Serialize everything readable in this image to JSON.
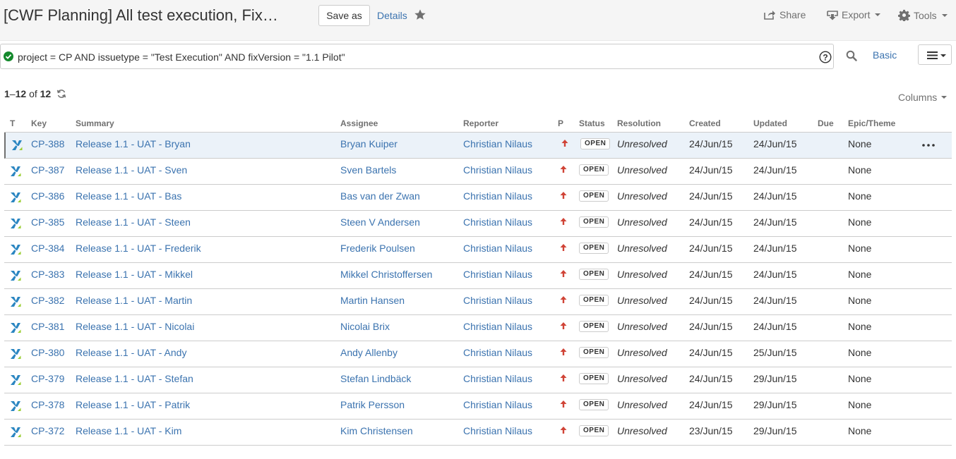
{
  "header": {
    "title": "[CWF Planning] All test execution, Fix…",
    "save_label": "Save as",
    "details_label": "Details",
    "share_label": "Share",
    "export_label": "Export",
    "tools_label": "Tools"
  },
  "search": {
    "query": "project = CP AND issuetype = \"Test Execution\" AND fixVersion = \"1.1 Pilot\"",
    "basic_label": "Basic"
  },
  "results": {
    "start": "1",
    "end": "12",
    "of_label": "of",
    "total": "12",
    "columns_label": "Columns"
  },
  "table": {
    "headers": {
      "type": "T",
      "key": "Key",
      "summary": "Summary",
      "assignee": "Assignee",
      "reporter": "Reporter",
      "priority": "P",
      "status": "Status",
      "resolution": "Resolution",
      "created": "Created",
      "updated": "Updated",
      "due": "Due",
      "epic": "Epic/Theme"
    },
    "rows": [
      {
        "key": "CP-388",
        "summary": "Release 1.1 - UAT - Bryan",
        "assignee": "Bryan Kuiper",
        "reporter": "Christian Nilaus",
        "status": "OPEN",
        "resolution": "Unresolved",
        "created": "24/Jun/15",
        "updated": "24/Jun/15",
        "due": "",
        "epic": "None"
      },
      {
        "key": "CP-387",
        "summary": "Release 1.1 - UAT - Sven",
        "assignee": "Sven Bartels",
        "reporter": "Christian Nilaus",
        "status": "OPEN",
        "resolution": "Unresolved",
        "created": "24/Jun/15",
        "updated": "24/Jun/15",
        "due": "",
        "epic": "None"
      },
      {
        "key": "CP-386",
        "summary": "Release 1.1 - UAT - Bas",
        "assignee": "Bas van der Zwan",
        "reporter": "Christian Nilaus",
        "status": "OPEN",
        "resolution": "Unresolved",
        "created": "24/Jun/15",
        "updated": "24/Jun/15",
        "due": "",
        "epic": "None"
      },
      {
        "key": "CP-385",
        "summary": "Release 1.1 - UAT - Steen",
        "assignee": "Steen V Andersen",
        "reporter": "Christian Nilaus",
        "status": "OPEN",
        "resolution": "Unresolved",
        "created": "24/Jun/15",
        "updated": "24/Jun/15",
        "due": "",
        "epic": "None"
      },
      {
        "key": "CP-384",
        "summary": "Release 1.1 - UAT - Frederik",
        "assignee": "Frederik Poulsen",
        "reporter": "Christian Nilaus",
        "status": "OPEN",
        "resolution": "Unresolved",
        "created": "24/Jun/15",
        "updated": "24/Jun/15",
        "due": "",
        "epic": "None"
      },
      {
        "key": "CP-383",
        "summary": "Release 1.1 - UAT - Mikkel",
        "assignee": "Mikkel Christoffersen",
        "reporter": "Christian Nilaus",
        "status": "OPEN",
        "resolution": "Unresolved",
        "created": "24/Jun/15",
        "updated": "24/Jun/15",
        "due": "",
        "epic": "None"
      },
      {
        "key": "CP-382",
        "summary": "Release 1.1 - UAT - Martin",
        "assignee": "Martin Hansen",
        "reporter": "Christian Nilaus",
        "status": "OPEN",
        "resolution": "Unresolved",
        "created": "24/Jun/15",
        "updated": "24/Jun/15",
        "due": "",
        "epic": "None"
      },
      {
        "key": "CP-381",
        "summary": "Release 1.1 - UAT - Nicolai",
        "assignee": "Nicolai Brix",
        "reporter": "Christian Nilaus",
        "status": "OPEN",
        "resolution": "Unresolved",
        "created": "24/Jun/15",
        "updated": "24/Jun/15",
        "due": "",
        "epic": "None"
      },
      {
        "key": "CP-380",
        "summary": "Release 1.1 - UAT - Andy",
        "assignee": "Andy Allenby",
        "reporter": "Christian Nilaus",
        "status": "OPEN",
        "resolution": "Unresolved",
        "created": "24/Jun/15",
        "updated": "25/Jun/15",
        "due": "",
        "epic": "None"
      },
      {
        "key": "CP-379",
        "summary": "Release 1.1 - UAT - Stefan",
        "assignee": "Stefan Lindbäck",
        "reporter": "Christian Nilaus",
        "status": "OPEN",
        "resolution": "Unresolved",
        "created": "24/Jun/15",
        "updated": "29/Jun/15",
        "due": "",
        "epic": "None"
      },
      {
        "key": "CP-378",
        "summary": "Release 1.1 - UAT - Patrik",
        "assignee": "Patrik Persson",
        "reporter": "Christian Nilaus",
        "status": "OPEN",
        "resolution": "Unresolved",
        "created": "24/Jun/15",
        "updated": "29/Jun/15",
        "due": "",
        "epic": "None"
      },
      {
        "key": "CP-372",
        "summary": "Release 1.1 - UAT - Kim",
        "assignee": "Kim Christensen",
        "reporter": "Christian Nilaus",
        "status": "OPEN",
        "resolution": "Unresolved",
        "created": "23/Jun/15",
        "updated": "29/Jun/15",
        "due": "",
        "epic": "None"
      }
    ]
  },
  "colors": {
    "link": "#3b73af",
    "priority_high": "#d04437",
    "success": "#14892c",
    "selected_row": "#ebf2f9"
  },
  "icons": {
    "star": "star-icon",
    "share": "share-icon",
    "export": "export-icon",
    "tools": "gear-icon",
    "query_ok": "check-circle-icon",
    "help": "help-icon",
    "search": "search-icon",
    "view": "list-view-icon",
    "refresh": "refresh-icon",
    "issue_type": "test-execution-icon",
    "priority": "priority-major-icon",
    "more": "more-actions-icon"
  }
}
